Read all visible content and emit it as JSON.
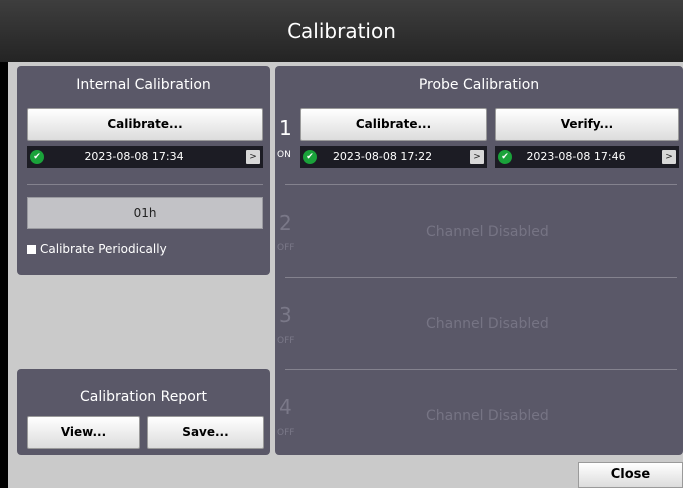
{
  "window": {
    "title": "Calibration"
  },
  "internal": {
    "title": "Internal Calibration",
    "calibrate_label": "Calibrate...",
    "last_date": "2023-08-08 17:34",
    "interval": "01h",
    "periodic_label": "Calibrate Periodically",
    "periodic_checked": false
  },
  "probe": {
    "title": "Probe Calibration",
    "channels": [
      {
        "number": "1",
        "state": "ON",
        "calibrate_label": "Calibrate...",
        "verify_label": "Verify...",
        "calibrate_date": "2023-08-08 17:22",
        "verify_date": "2023-08-08 17:46"
      },
      {
        "number": "2",
        "state": "OFF",
        "message": "Channel Disabled"
      },
      {
        "number": "3",
        "state": "OFF",
        "message": "Channel Disabled"
      },
      {
        "number": "4",
        "state": "OFF",
        "message": "Channel Disabled"
      }
    ]
  },
  "report": {
    "title": "Calibration Report",
    "view_label": "View...",
    "save_label": "Save..."
  },
  "footer": {
    "close_label": "Close"
  },
  "icons": {
    "status_ok": "check-circle-icon",
    "details": "chevron-right-icon"
  },
  "colors": {
    "panel": "#5a5868",
    "ok": "#1aa23a"
  }
}
